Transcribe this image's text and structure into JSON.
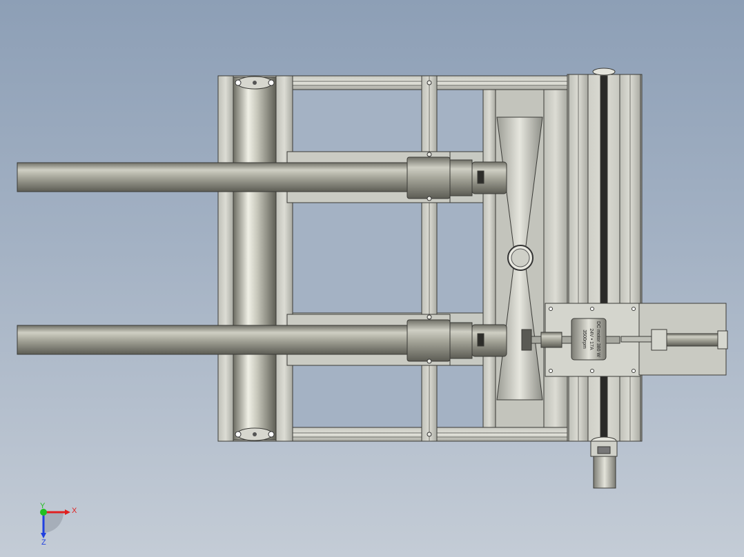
{
  "model_view": {
    "motor_label": {
      "line1": "DC motor 380 W",
      "line2": "24V • 17A",
      "line3": "3500rpm"
    }
  },
  "triad": {
    "x_label": "X",
    "y_label": "Y",
    "z_label": "Z"
  },
  "colors": {
    "background_top": "#8d9fb6",
    "background_bottom": "#c4ccd6",
    "axis_x": "#e02020",
    "axis_y": "#20c020",
    "axis_z": "#2040e0"
  }
}
